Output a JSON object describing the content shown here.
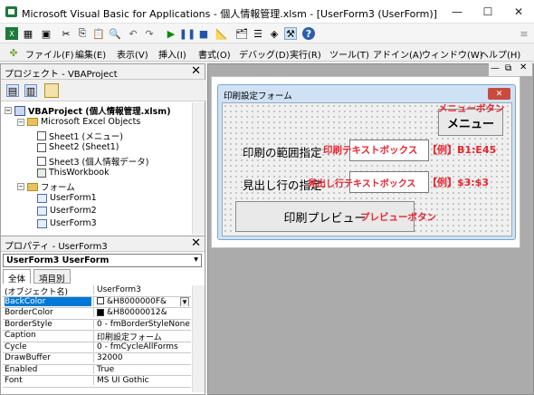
{
  "window": {
    "title": "Microsoft Visual Basic for Applications - 個人情報管理.xlsm - [UserForm3 (UserForm)]",
    "minimize": "—",
    "maximize": "☐",
    "close": "✕"
  },
  "menu": {
    "items": [
      "ファイル(F)",
      "編集(E)",
      "表示(V)",
      "挿入(I)",
      "書式(O)",
      "デバッグ(D)",
      "実行(R)",
      "ツール(T)",
      "アドイン(A)",
      "ウィンドウ(W)",
      "ヘルプ(H)"
    ]
  },
  "project": {
    "header": "プロジェクト - VBAProject",
    "close": "✕",
    "nodes": [
      {
        "label": "VBAProject (個人情報管理.xlsm)",
        "bold": true
      },
      {
        "label": "Microsoft Excel Objects"
      },
      {
        "label": "Sheet1 (メニュー)"
      },
      {
        "label": "Sheet2 (Sheet1)"
      },
      {
        "label": "Sheet3 (個人情報データ)"
      },
      {
        "label": "ThisWorkbook"
      },
      {
        "label": "フォーム"
      },
      {
        "label": "UserForm1"
      },
      {
        "label": "UserForm2"
      },
      {
        "label": "UserForm3"
      }
    ]
  },
  "properties": {
    "header": "プロパティ - UserForm3",
    "close": "✕",
    "object_selector": "UserForm3  UserForm",
    "tabs": [
      "全体",
      "項目別"
    ],
    "rows": [
      {
        "key": "(オブジェクト名)",
        "value": "UserForm3"
      },
      {
        "key": "BackColor",
        "value": "&H8000000F&"
      },
      {
        "key": "BorderColor",
        "value": "&H80000012&"
      },
      {
        "key": "BorderStyle",
        "value": "0 - fmBorderStyleNone"
      },
      {
        "key": "Caption",
        "value": "印刷設定フォーム"
      },
      {
        "key": "Cycle",
        "value": "0 - fmCycleAllForms"
      },
      {
        "key": "DrawBuffer",
        "value": "32000"
      },
      {
        "key": "Enabled",
        "value": "True"
      },
      {
        "key": "Font",
        "value": "MS UI Gothic"
      }
    ]
  },
  "designer": {
    "form_caption": "印刷設定フォーム",
    "form_close": "✕",
    "menu_button": "メニュー",
    "label_range": "印刷の範囲指定",
    "label_title_rows": "見出し行の指定",
    "preview_button": "印刷プレビュー",
    "annotations": {
      "menu_button": "メニューボタン",
      "range_textbox": "印刷テキストボックス",
      "range_example": "【例】B1:E45",
      "title_textbox": "見出し行テキストボックス",
      "title_example": "【例】$3:$3",
      "preview_button": "プレビューボタン"
    }
  },
  "colors": {
    "annotation": "#e8242f",
    "selected": "#0078d7"
  }
}
